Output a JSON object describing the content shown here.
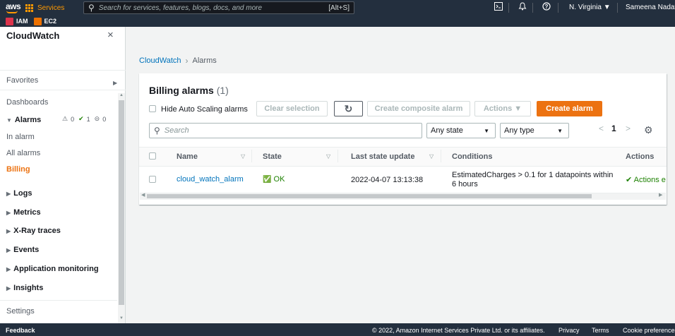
{
  "topnav": {
    "logo": "aws",
    "services_label": "Services",
    "search_placeholder": "Search for services, features, blogs, docs, and more",
    "search_shortcut": "[Alt+S]",
    "region": "N. Virginia ▼",
    "user": "Sameena Nadaf ▼",
    "icons": [
      "cloudshell-icon",
      "bell-icon",
      "help-icon"
    ]
  },
  "favorites_bar": [
    {
      "label": "IAM",
      "color": "#dd344c"
    },
    {
      "label": "EC2",
      "color": "#ed7100"
    }
  ],
  "sidebar": {
    "title": "CloudWatch",
    "close": "×",
    "favorites": "Favorites",
    "dashboards": "Dashboards",
    "alarms": "Alarms",
    "alarm_counts": {
      "alarm": "0",
      "ok": "1",
      "insufficient": "0"
    },
    "in_alarm": "In alarm",
    "all_alarms": "All alarms",
    "billing": "Billing",
    "logs": "Logs",
    "metrics": "Metrics",
    "xray": "X-Ray traces",
    "events": "Events",
    "app_monitoring": "Application monitoring",
    "insights": "Insights",
    "settings": "Settings"
  },
  "breadcrumb": {
    "root": "CloudWatch",
    "current": "Alarms"
  },
  "panel": {
    "title": "Billing alarms",
    "count": "(1)",
    "hide_autoscaling": "Hide Auto Scaling alarms",
    "clear_selection": "Clear selection",
    "refresh": "↻",
    "create_composite": "Create composite alarm",
    "actions": "Actions ▼",
    "create_alarm": "Create alarm",
    "filter_placeholder": "Search",
    "state_select": "Any state",
    "type_select": "Any type",
    "page_prev": "<",
    "page_num": "1",
    "page_next": ">"
  },
  "table": {
    "headers": {
      "name": "Name",
      "state": "State",
      "last_update": "Last state update",
      "conditions": "Conditions",
      "actions": "Actions"
    },
    "rows": [
      {
        "name": "cloud_watch_alarm",
        "state": "OK",
        "last_update": "2022-04-07 13:13:38",
        "conditions": "EstimatedCharges > 0.1 for 1 datapoints within 6 hours",
        "actions": "Actions e"
      }
    ]
  },
  "footer": {
    "feedback": "Feedback",
    "copyright": "© 2022, Amazon Internet Services Private Ltd. or its affiliates.",
    "privacy": "Privacy",
    "terms": "Terms",
    "cookies": "Cookie preferences"
  }
}
